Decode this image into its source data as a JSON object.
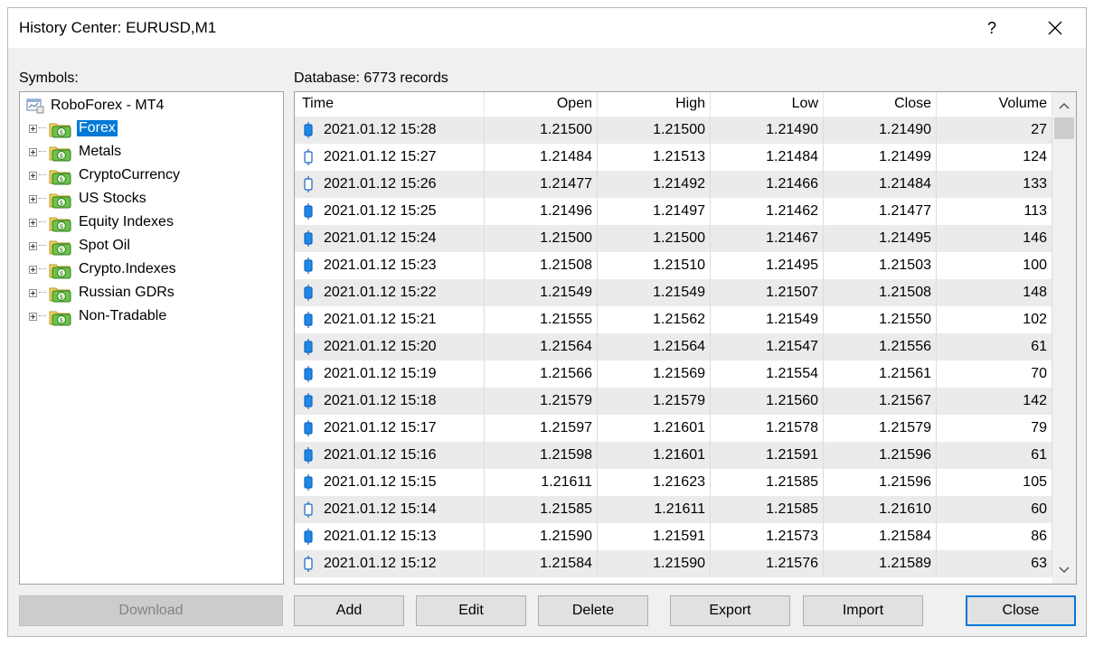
{
  "window": {
    "title": "History Center: EURUSD,M1",
    "help_label": "?"
  },
  "symbols": {
    "label": "Symbols:",
    "root": "RoboForex - MT4",
    "groups": [
      {
        "label": "Forex",
        "selected": true
      },
      {
        "label": "Metals"
      },
      {
        "label": "CryptoCurrency"
      },
      {
        "label": "US Stocks"
      },
      {
        "label": "Equity Indexes"
      },
      {
        "label": "Spot Oil"
      },
      {
        "label": "Crypto.Indexes"
      },
      {
        "label": "Russian GDRs"
      },
      {
        "label": "Non-Tradable"
      }
    ]
  },
  "database": {
    "label": "Database: 6773 records",
    "columns": [
      "Time",
      "Open",
      "High",
      "Low",
      "Close",
      "Volume"
    ],
    "rows": [
      {
        "candle": "bull",
        "time": "2021.01.12 15:28",
        "open": "1.21500",
        "high": "1.21500",
        "low": "1.21490",
        "close": "1.21490",
        "volume": "27"
      },
      {
        "candle": "bear",
        "time": "2021.01.12 15:27",
        "open": "1.21484",
        "high": "1.21513",
        "low": "1.21484",
        "close": "1.21499",
        "volume": "124"
      },
      {
        "candle": "bear",
        "time": "2021.01.12 15:26",
        "open": "1.21477",
        "high": "1.21492",
        "low": "1.21466",
        "close": "1.21484",
        "volume": "133"
      },
      {
        "candle": "bull",
        "time": "2021.01.12 15:25",
        "open": "1.21496",
        "high": "1.21497",
        "low": "1.21462",
        "close": "1.21477",
        "volume": "113"
      },
      {
        "candle": "bull",
        "time": "2021.01.12 15:24",
        "open": "1.21500",
        "high": "1.21500",
        "low": "1.21467",
        "close": "1.21495",
        "volume": "146"
      },
      {
        "candle": "bull",
        "time": "2021.01.12 15:23",
        "open": "1.21508",
        "high": "1.21510",
        "low": "1.21495",
        "close": "1.21503",
        "volume": "100"
      },
      {
        "candle": "bull",
        "time": "2021.01.12 15:22",
        "open": "1.21549",
        "high": "1.21549",
        "low": "1.21507",
        "close": "1.21508",
        "volume": "148"
      },
      {
        "candle": "bull",
        "time": "2021.01.12 15:21",
        "open": "1.21555",
        "high": "1.21562",
        "low": "1.21549",
        "close": "1.21550",
        "volume": "102"
      },
      {
        "candle": "bull",
        "time": "2021.01.12 15:20",
        "open": "1.21564",
        "high": "1.21564",
        "low": "1.21547",
        "close": "1.21556",
        "volume": "61"
      },
      {
        "candle": "bull",
        "time": "2021.01.12 15:19",
        "open": "1.21566",
        "high": "1.21569",
        "low": "1.21554",
        "close": "1.21561",
        "volume": "70"
      },
      {
        "candle": "bull",
        "time": "2021.01.12 15:18",
        "open": "1.21579",
        "high": "1.21579",
        "low": "1.21560",
        "close": "1.21567",
        "volume": "142"
      },
      {
        "candle": "bull",
        "time": "2021.01.12 15:17",
        "open": "1.21597",
        "high": "1.21601",
        "low": "1.21578",
        "close": "1.21579",
        "volume": "79"
      },
      {
        "candle": "bull",
        "time": "2021.01.12 15:16",
        "open": "1.21598",
        "high": "1.21601",
        "low": "1.21591",
        "close": "1.21596",
        "volume": "61"
      },
      {
        "candle": "bull",
        "time": "2021.01.12 15:15",
        "open": "1.21611",
        "high": "1.21623",
        "low": "1.21585",
        "close": "1.21596",
        "volume": "105"
      },
      {
        "candle": "bear",
        "time": "2021.01.12 15:14",
        "open": "1.21585",
        "high": "1.21611",
        "low": "1.21585",
        "close": "1.21610",
        "volume": "60"
      },
      {
        "candle": "bull",
        "time": "2021.01.12 15:13",
        "open": "1.21590",
        "high": "1.21591",
        "low": "1.21573",
        "close": "1.21584",
        "volume": "86"
      },
      {
        "candle": "bear",
        "time": "2021.01.12 15:12",
        "open": "1.21584",
        "high": "1.21590",
        "low": "1.21576",
        "close": "1.21589",
        "volume": "63"
      }
    ]
  },
  "buttons": {
    "download": "Download",
    "add": "Add",
    "edit": "Edit",
    "delete": "Delete",
    "export": "Export",
    "import": "Import",
    "close": "Close"
  },
  "colors": {
    "selection": "#0078d7",
    "candle_fill": "#1e88e5"
  }
}
